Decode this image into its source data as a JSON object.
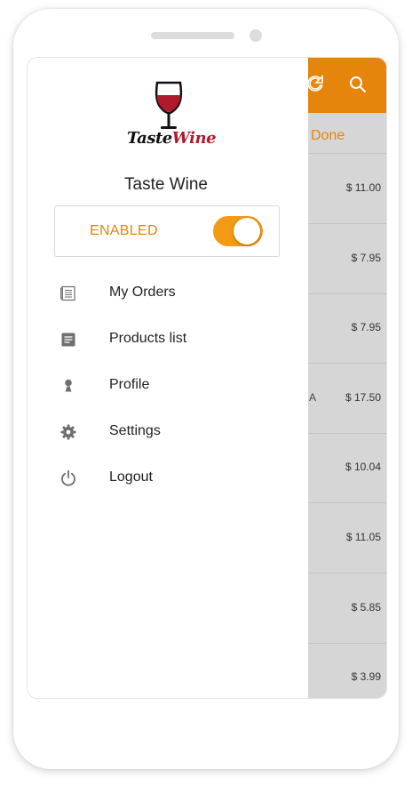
{
  "app": {
    "name": "Taste Wine",
    "logo_text_part1": "Taste",
    "logo_text_part2": "Wine",
    "accent_color": "#e5850b"
  },
  "status": {
    "label": "ENABLED",
    "enabled": true
  },
  "menu": [
    {
      "label": "My Orders",
      "icon": "orders-list-icon"
    },
    {
      "label": "Products list",
      "icon": "document-icon"
    },
    {
      "label": "Profile",
      "icon": "person-icon"
    },
    {
      "label": "Settings",
      "icon": "gear-icon"
    },
    {
      "label": "Logout",
      "icon": "power-icon"
    }
  ],
  "background": {
    "tab_label": "Done",
    "toolbar_icons": [
      "refresh-icon",
      "search-icon"
    ],
    "rows": [
      {
        "fragment": "",
        "price": "$ 11.00"
      },
      {
        "fragment": "",
        "price": "$ 7.95"
      },
      {
        "fragment": "",
        "price": "$ 7.95"
      },
      {
        "fragment": "A",
        "price": "$ 17.50"
      },
      {
        "fragment": "",
        "price": "$ 10.04"
      },
      {
        "fragment": "",
        "price": "$ 11.05"
      },
      {
        "fragment": "",
        "price": "$ 5.85"
      },
      {
        "fragment": "",
        "price": "$ 3.99"
      }
    ]
  }
}
